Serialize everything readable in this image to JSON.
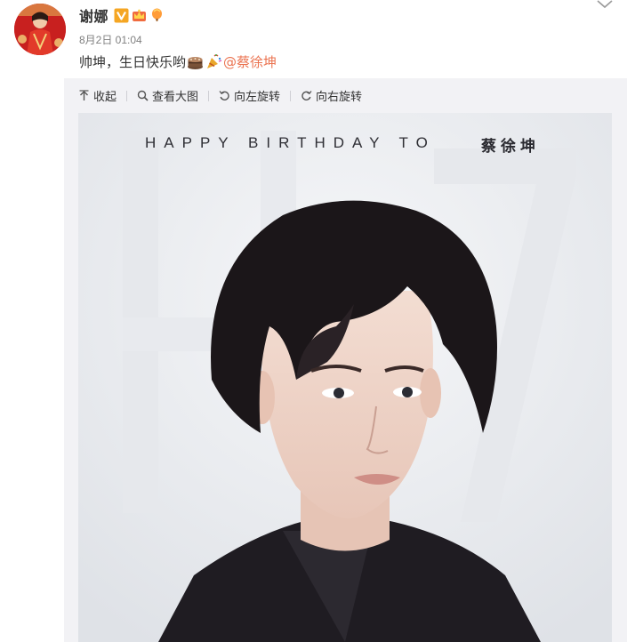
{
  "post": {
    "author": "谢娜",
    "time": "8月2日 01:04",
    "text_before": "帅坤，生日快乐哟",
    "mention": "@蔡徐坤",
    "emojis": [
      "cake-emoji",
      "party-popper-emoji"
    ]
  },
  "toolbar": {
    "collapse": "收起",
    "view_large": "查看大图",
    "rotate_left": "向左旋转",
    "rotate_right": "向右旋转"
  },
  "image": {
    "caption": "HAPPY BIRTHDAY TO",
    "name": "蔡徐坤"
  },
  "icons": {
    "verified": "verified-v-icon",
    "vip_crown": "crown-badge-icon",
    "balloon": "balloon-badge-icon",
    "more": "chevron-down-icon",
    "collapse": "collapse-up-icon",
    "zoom": "magnifier-icon",
    "rotate_left": "rotate-left-icon",
    "rotate_right": "rotate-right-icon"
  },
  "colors": {
    "mention": "#eb7350",
    "verified": "#f5a623",
    "media_background": "#f2f2f5"
  }
}
